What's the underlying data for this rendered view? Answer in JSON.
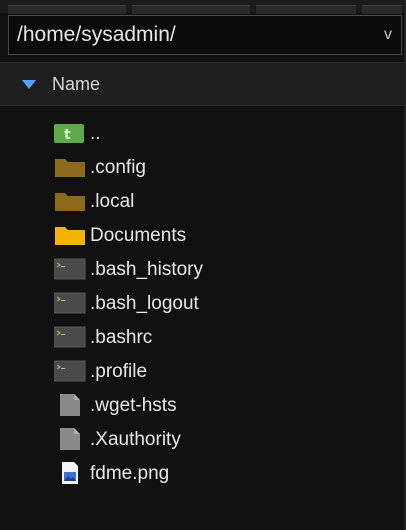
{
  "path_bar": {
    "value": "/home/sysadmin/",
    "dropdown_glyph": "v"
  },
  "column_header": {
    "label": "Name",
    "sort_direction": "ascending",
    "sort_icon_color": "#5aa0ff"
  },
  "files": [
    {
      "name": "..",
      "icon": "parent-folder-icon",
      "color": "#5faa4a"
    },
    {
      "name": ".config",
      "icon": "folder-icon",
      "color": "#8b6a1e"
    },
    {
      "name": ".local",
      "icon": "folder-icon",
      "color": "#8b6a1e"
    },
    {
      "name": "Documents",
      "icon": "folder-icon",
      "color": "#f2b300"
    },
    {
      "name": ".bash_history",
      "icon": "terminal-file-icon",
      "color": "#4a4a4a"
    },
    {
      "name": ".bash_logout",
      "icon": "terminal-file-icon",
      "color": "#4a4a4a"
    },
    {
      "name": ".bashrc",
      "icon": "terminal-file-icon",
      "color": "#4a4a4a"
    },
    {
      "name": ".profile",
      "icon": "terminal-file-icon",
      "color": "#4a4a4a"
    },
    {
      "name": ".wget-hsts",
      "icon": "document-icon",
      "color": "#8a8a8a"
    },
    {
      "name": ".Xauthority",
      "icon": "document-icon",
      "color": "#8a8a8a"
    },
    {
      "name": "fdme.png",
      "icon": "image-file-icon",
      "color": "#3d6fd6"
    }
  ]
}
